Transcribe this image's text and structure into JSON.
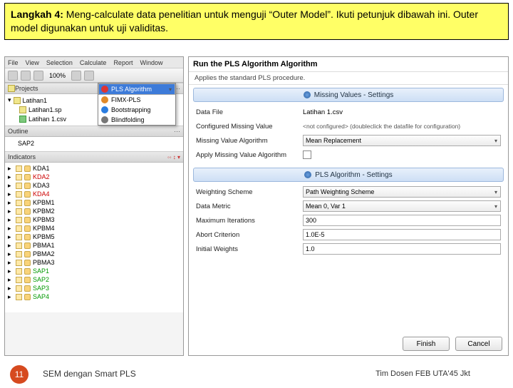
{
  "header": {
    "bold": "Langkah 4:",
    "rest": " Meng-calculate data penelitian untuk menguji “Outer Model”. Ikuti petunjuk dibawah ini. Outer model digunakan untuk uji validitas."
  },
  "leftApp": {
    "menu": [
      "File",
      "View",
      "Selection",
      "Calculate",
      "Report",
      "Window"
    ],
    "zoom": "100%",
    "dropdown": [
      {
        "label": "PLS Algorithm",
        "sel": true,
        "color": "#d33"
      },
      {
        "label": "FIMX-PLS",
        "sel": false,
        "color": "#e08a2a"
      },
      {
        "label": "Bootstrapping",
        "sel": false,
        "color": "#2a7de0"
      },
      {
        "label": "Blindfolding",
        "sel": false,
        "color": "#777"
      }
    ],
    "projectsTitle": "Projects",
    "projects": [
      {
        "label": "Latihan1",
        "ico": "fold"
      },
      {
        "label": "Latihan1.sp",
        "ico": "file",
        "indent": 1
      },
      {
        "label": "Latihan 1.csv",
        "ico": "grn",
        "indent": 1
      }
    ],
    "outlineTitle": "Outline",
    "outlineSub": "SAP2",
    "indicatorsTitle": "Indicators",
    "indicators": [
      {
        "t": "KDA1",
        "c": ""
      },
      {
        "t": "KDA2",
        "c": "red"
      },
      {
        "t": "KDA3",
        "c": ""
      },
      {
        "t": "KDA4",
        "c": "red"
      },
      {
        "t": "KPBM1",
        "c": ""
      },
      {
        "t": "KPBM2",
        "c": ""
      },
      {
        "t": "KPBM3",
        "c": ""
      },
      {
        "t": "KPBM4",
        "c": ""
      },
      {
        "t": "KPBM5",
        "c": ""
      },
      {
        "t": "PBMA1",
        "c": ""
      },
      {
        "t": "PBMA2",
        "c": ""
      },
      {
        "t": "PBMA3",
        "c": ""
      },
      {
        "t": "SAP1",
        "c": "green"
      },
      {
        "t": "SAP2",
        "c": "green"
      },
      {
        "t": "SAP3",
        "c": "green"
      },
      {
        "t": "SAP4",
        "c": "green"
      }
    ]
  },
  "rightApp": {
    "title": "Run the PLS Algorithm Algorithm",
    "subtitle": "Applies the standard PLS procedure.",
    "sect1": "Missing Values - Settings",
    "dataFileLab": "Data File",
    "dataFileVal": "Latihan 1.csv",
    "cmvLab": "Configured Missing Value",
    "cmvVal": "<not configured>  (doubleclick the datafile for configuration)",
    "mvaLab": "Missing Value Algorithm",
    "mvaVal": "Mean Replacement",
    "amvLab": "Apply Missing Value Algorithm",
    "sect2": "PLS Algorithm - Settings",
    "wsLab": "Weighting Scheme",
    "wsVal": "Path Weighting Scheme",
    "dmLab": "Data Metric",
    "dmVal": "Mean 0, Var 1",
    "miLab": "Maximum Iterations",
    "miVal": "300",
    "acLab": "Abort Criterion",
    "acVal": "1.0E-5",
    "iwLab": "Initial Weights",
    "iwVal": "1.0",
    "finish": "Finish",
    "cancel": "Cancel"
  },
  "footer": {
    "page": "11",
    "left": "SEM dengan Smart PLS",
    "right": "Tim Dosen FEB UTA'45 Jkt"
  }
}
